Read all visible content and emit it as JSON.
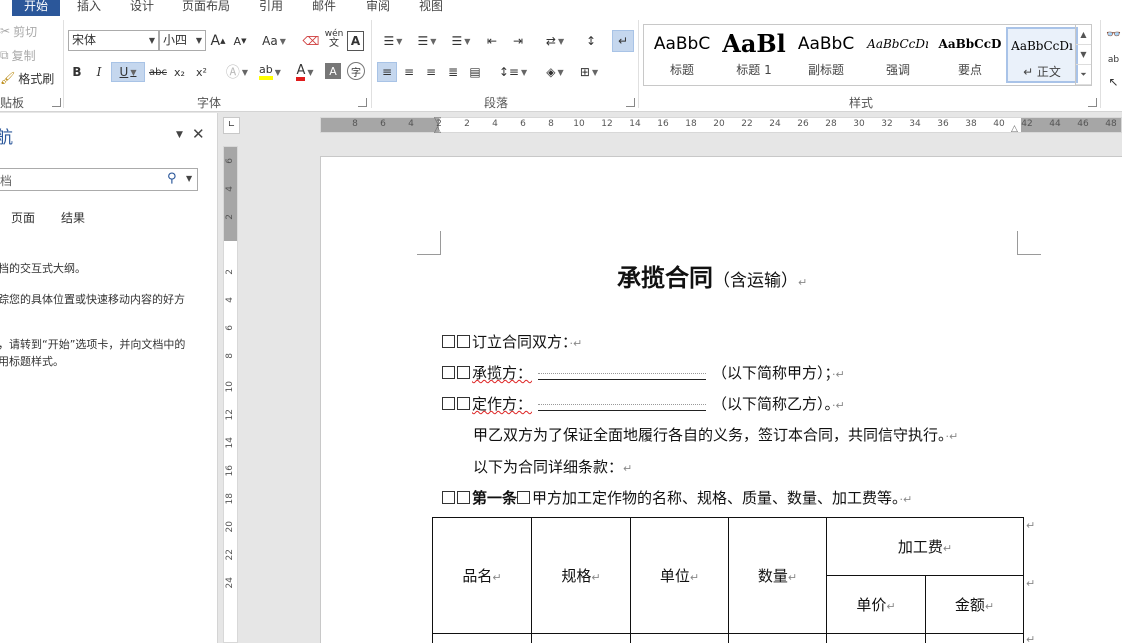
{
  "ribbon_tabs": [
    "开始",
    "插入",
    "设计",
    "页面布局",
    "引用",
    "邮件",
    "审阅",
    "视图"
  ],
  "clipboard": {
    "cut": "剪切",
    "copy": "复制",
    "format_painter": "格式刷",
    "group_label": "贴板"
  },
  "font": {
    "family": "宋体",
    "size": "小四",
    "group_label": "字体",
    "grow": "A",
    "shrink": "A",
    "change_case": "Aa",
    "bold": "B",
    "italic": "I",
    "underline": "U",
    "strike": "abc",
    "subscript": "x₂",
    "superscript": "x²",
    "highlight_color": "#ffff00",
    "font_color": "#e01b1b",
    "phonetic": "wén",
    "enclose": "字"
  },
  "paragraph": {
    "group_label": "段落"
  },
  "styles": {
    "group_label": "样式",
    "items": [
      {
        "preview": "AaBbC",
        "name": "标题"
      },
      {
        "preview": "AaBl",
        "name": "标题 1"
      },
      {
        "preview": "AaBbC",
        "name": "副标题"
      },
      {
        "preview": "AaBbCcDı",
        "name": "强调"
      },
      {
        "preview": "AaBbCcD",
        "name": "要点"
      },
      {
        "preview": "AaBbCcDı",
        "name": "↵ 正文"
      }
    ]
  },
  "nav_pane": {
    "title": "航",
    "search_placeholder": "档",
    "tabs": [
      "页面",
      "结果"
    ],
    "lines": [
      "档的交互式大纲。",
      "踪您的具体位置或快速移动内容的好方",
      "，请转到“开始”选项卡，并向文档中的",
      "用标题样式。"
    ]
  },
  "hruler_ticks": [
    "8",
    "6",
    "4",
    "2",
    "2",
    "4",
    "6",
    "8",
    "10",
    "12",
    "14",
    "16",
    "18",
    "20",
    "22",
    "24",
    "26",
    "28",
    "30",
    "32",
    "34",
    "36",
    "38",
    "40",
    "42",
    "44",
    "46",
    "48"
  ],
  "vruler_ticks": [
    "6",
    "4",
    "2",
    "2",
    "4",
    "6",
    "8",
    "10",
    "12",
    "14",
    "16",
    "18",
    "20",
    "22",
    "24"
  ],
  "document": {
    "title": "承揽合同",
    "title_suffix": "（含运输）",
    "para_mark": "↵",
    "lines": {
      "party_intro": "订立合同双方：",
      "contractor_label": "承揽方：",
      "contractor_suffix": "（以下简称甲方）；",
      "orderer_label": "定作方：",
      "orderer_suffix": "（以下简称乙方）。",
      "purpose": "甲乙双方为了保证全面地履行各自的义务，签订本合同，共同信守执行。",
      "details_intro": "以下为合同详细条款：",
      "article1_head": "第一条",
      "article1_body": "甲方加工定作物的名称、规格、质量、数量、加工费等。"
    },
    "table": {
      "headers": [
        "品名",
        "规格",
        "单位",
        "数量",
        "加工费"
      ],
      "subheaders": [
        "单价",
        "金额"
      ]
    }
  }
}
